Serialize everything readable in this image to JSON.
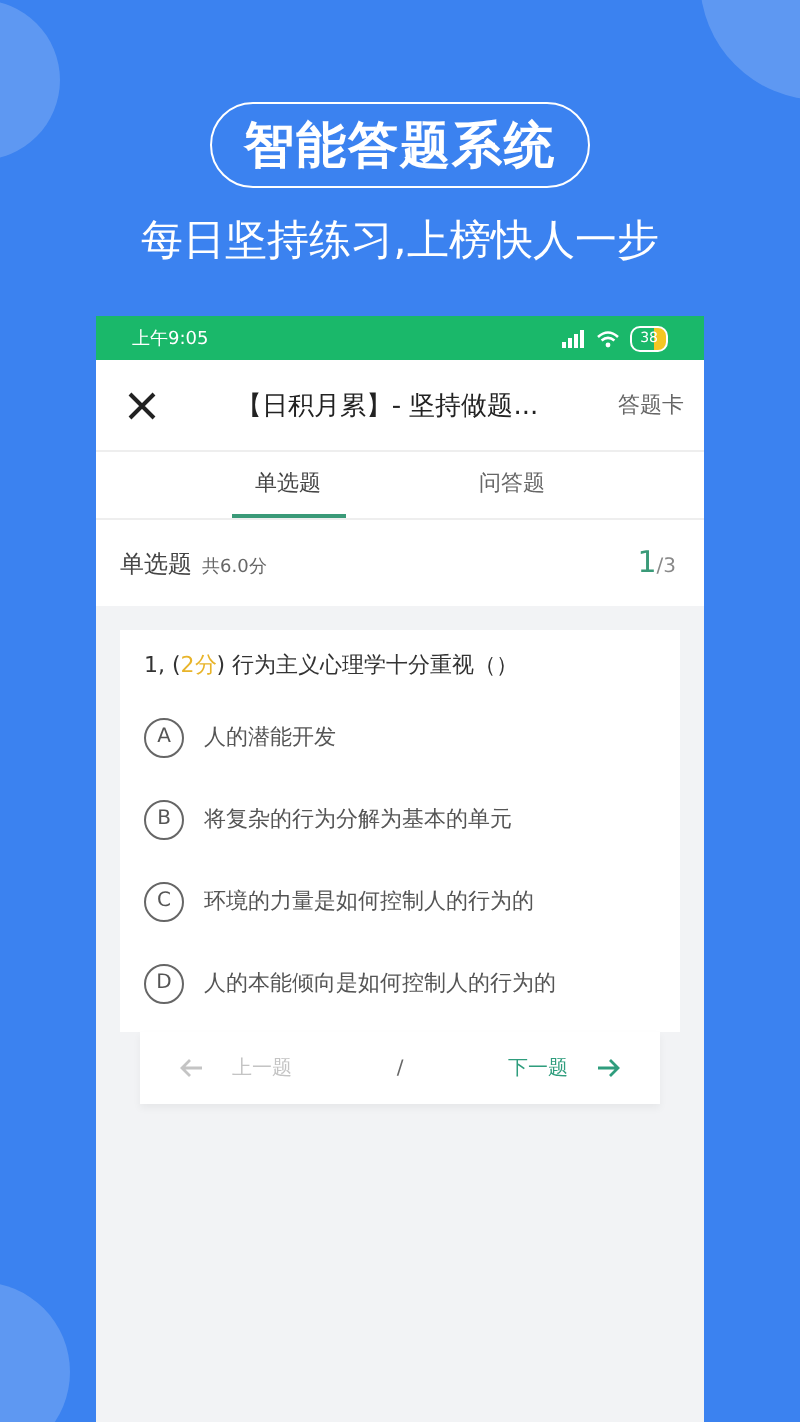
{
  "banner": {
    "title": "智能答题系统",
    "subtitle": "每日坚持练习,上榜快人一步"
  },
  "status_bar": {
    "time": "上午9:05",
    "battery": "38"
  },
  "header": {
    "title": "【日积月累】- 坚持做题...",
    "action": "答题卡"
  },
  "tabs": [
    {
      "label": "单选题",
      "selected": true
    },
    {
      "label": "问答题",
      "selected": false
    }
  ],
  "section": {
    "label": "单选题",
    "score": "共6.0分",
    "current": "1",
    "total": "/3"
  },
  "question": {
    "prefix": "1, (",
    "score": "2分",
    "text": ") 行为主义心理学十分重视（）"
  },
  "options": [
    {
      "letter": "A",
      "text": "人的潜能开发"
    },
    {
      "letter": "B",
      "text": "将复杂的行为分解为基本的单元"
    },
    {
      "letter": "C",
      "text": "环境的力量是如何控制人的行为的"
    },
    {
      "letter": "D",
      "text": "人的本能倾向是如何控制人的行为的"
    }
  ],
  "nav": {
    "prev": {
      "label": "上一题",
      "disabled": true
    },
    "separator": "/",
    "next": {
      "label": "下一题",
      "disabled": false
    }
  }
}
